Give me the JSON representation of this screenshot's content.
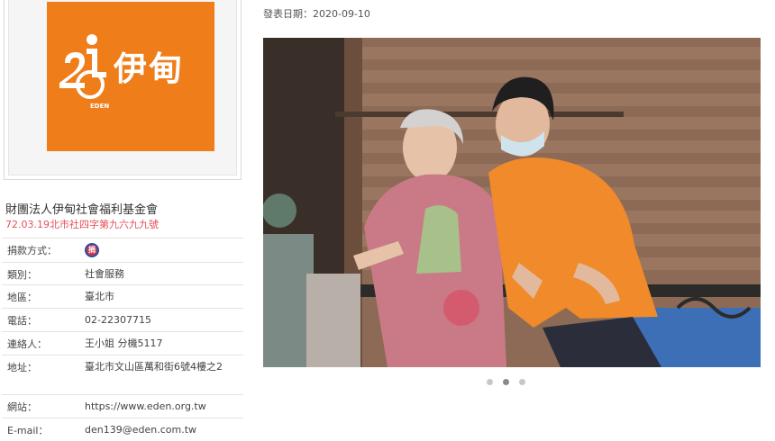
{
  "logo": {
    "brand_text": "伊甸",
    "sub_text": "EDEN",
    "color": "#ee7d1a"
  },
  "org": {
    "name": "財團法人伊甸社會福利基金會",
    "registration": "72.03.19北市社四字第九六九九號",
    "registration_color": "#e4505b"
  },
  "info": [
    {
      "key": "捐款方式：",
      "value": "",
      "icon": "donation-badge-icon"
    },
    {
      "key": "類別：",
      "value": "社會服務"
    },
    {
      "key": "地區：",
      "value": "臺北市"
    },
    {
      "key": "電話：",
      "value": "02-22307715"
    },
    {
      "key": "連絡人：",
      "value": "王小姐 分機5117"
    },
    {
      "key": "地址：",
      "value": "臺北市文山區萬和街6號4樓之2"
    },
    {
      "key": "網站：",
      "value": "https://www.eden.org.tw"
    },
    {
      "key": "E-mail：",
      "value": "den139@eden.com.tw"
    }
  ],
  "article": {
    "pub_label": "發表日期：",
    "pub_date": "2020-09-10",
    "photo_alt": "photo of elderly woman and caregiver on balcony",
    "carousel": {
      "total": 3,
      "active": 2
    }
  }
}
